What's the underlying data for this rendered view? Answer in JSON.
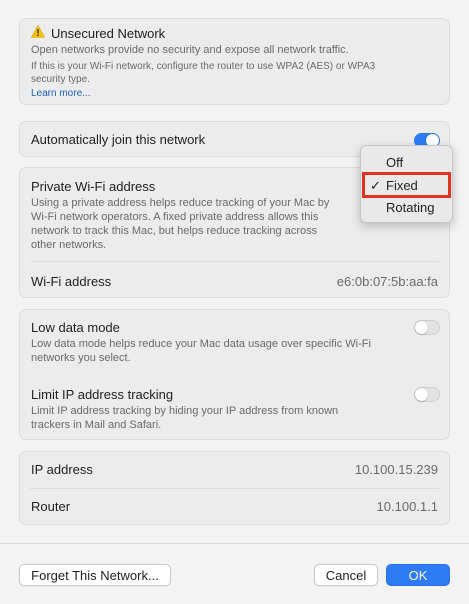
{
  "warning": {
    "title": "Unsecured Network",
    "line1": "Open networks provide no security and expose all network traffic.",
    "line2": "If this is your Wi-Fi network, configure the router to use WPA2 (AES) or WPA3",
    "line3": "security type.",
    "learn_more": "Learn more..."
  },
  "auto_join": {
    "label": "Automatically join this network",
    "enabled": true
  },
  "private_address": {
    "title": "Private Wi-Fi address",
    "desc_lines": [
      "Using a private address helps reduce tracking of your Mac by",
      "Wi-Fi network operators. A fixed private address allows this",
      "network to track this Mac, but helps reduce tracking across",
      "other networks."
    ],
    "wifi_address_label": "Wi-Fi address",
    "wifi_address_value": "e6:0b:07:5b:aa:fa"
  },
  "dropdown": {
    "options": [
      "Off",
      "Fixed",
      "Rotating"
    ],
    "selected": "Fixed",
    "check": "✓"
  },
  "low_data": {
    "title": "Low data mode",
    "desc_lines": [
      "Low data mode helps reduce your Mac data usage over specific Wi-Fi",
      "networks you select."
    ],
    "enabled": false
  },
  "limit_ip": {
    "title": "Limit IP address tracking",
    "desc_lines": [
      "Limit IP address tracking by hiding your IP address from known",
      "trackers in Mail and Safari."
    ],
    "enabled": false
  },
  "network_info": {
    "ip_label": "IP address",
    "ip_value": "10.100.15.239",
    "router_label": "Router",
    "router_value": "10.100.1.1"
  },
  "buttons": {
    "forget": "Forget This Network...",
    "cancel": "Cancel",
    "ok": "OK"
  },
  "colors": {
    "accent": "#2d7cf6",
    "highlight": "#e0321c",
    "warning": "#f5c400"
  }
}
